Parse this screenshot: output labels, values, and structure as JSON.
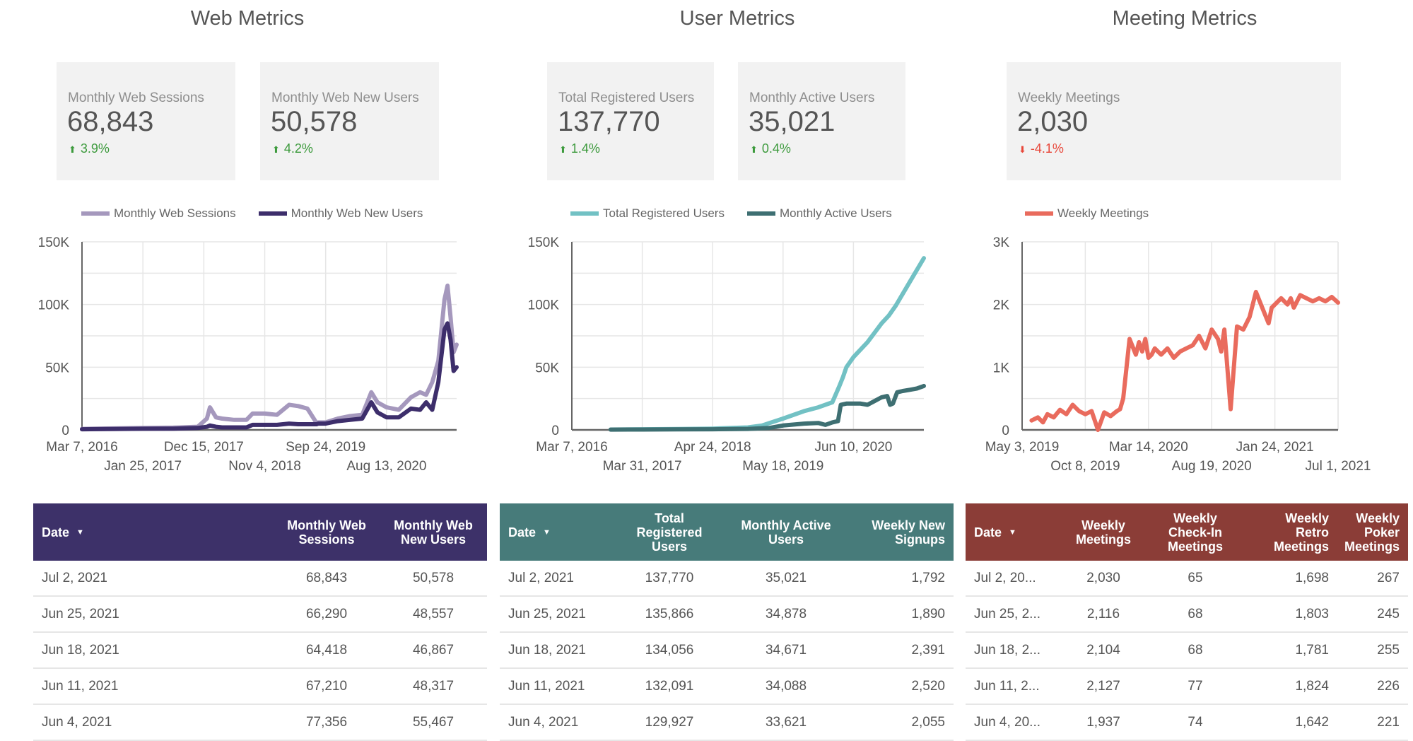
{
  "sections": {
    "web": {
      "title": "Web Metrics",
      "cards": [
        {
          "label": "Monthly Web Sessions",
          "value": "68,843",
          "delta": "3.9%",
          "direction": "up"
        },
        {
          "label": "Monthly Web New Users",
          "value": "50,578",
          "delta": "4.2%",
          "direction": "up"
        }
      ],
      "table": {
        "header_color": "#3d3169",
        "columns": [
          "Date",
          "Monthly Web Sessions",
          "Monthly Web New Users"
        ],
        "rows": [
          [
            "Jul 2, 2021",
            "68,843",
            "50,578"
          ],
          [
            "Jun 25, 2021",
            "66,290",
            "48,557"
          ],
          [
            "Jun 18, 2021",
            "64,418",
            "46,867"
          ],
          [
            "Jun 11, 2021",
            "67,210",
            "48,317"
          ],
          [
            "Jun 4, 2021",
            "77,356",
            "55,467"
          ]
        ]
      }
    },
    "user": {
      "title": "User Metrics",
      "cards": [
        {
          "label": "Total Registered Users",
          "value": "137,770",
          "delta": "1.4%",
          "direction": "up"
        },
        {
          "label": "Monthly Active Users",
          "value": "35,021",
          "delta": "0.4%",
          "direction": "up"
        }
      ],
      "table": {
        "header_color": "#477b7a",
        "columns": [
          "Date",
          "Total Registered Users",
          "Monthly Active Users",
          "Weekly New Signups"
        ],
        "rows": [
          [
            "Jul 2, 2021",
            "137,770",
            "35,021",
            "1,792"
          ],
          [
            "Jun 25, 2021",
            "135,866",
            "34,878",
            "1,890"
          ],
          [
            "Jun 18, 2021",
            "134,056",
            "34,671",
            "2,391"
          ],
          [
            "Jun 11, 2021",
            "132,091",
            "34,088",
            "2,520"
          ],
          [
            "Jun 4, 2021",
            "129,927",
            "33,621",
            "2,055"
          ]
        ]
      }
    },
    "meeting": {
      "title": "Meeting Metrics",
      "cards": [
        {
          "label": "Weekly Meetings",
          "value": "2,030",
          "delta": "-4.1%",
          "direction": "down"
        }
      ],
      "table": {
        "header_color": "#8b3d37",
        "columns": [
          "Date",
          "Weekly Meetings",
          "Weekly Check-In Meetings",
          "Weekly Retro Meetings",
          "Weekly Poker Meetings"
        ],
        "rows": [
          [
            "Jul 2, 20...",
            "2,030",
            "65",
            "1,698",
            "267"
          ],
          [
            "Jun 25, 2...",
            "2,116",
            "68",
            "1,803",
            "245"
          ],
          [
            "Jun 18, 2...",
            "2,104",
            "68",
            "1,781",
            "255"
          ],
          [
            "Jun 11, 2...",
            "2,127",
            "77",
            "1,824",
            "226"
          ],
          [
            "Jun 4, 20...",
            "1,937",
            "74",
            "1,642",
            "221"
          ]
        ]
      }
    }
  },
  "sort_icon": "sort-descending-triangle",
  "delta_icons": {
    "up": "arrow-up",
    "down": "arrow-down"
  },
  "colors": {
    "up": "#3c9a3c",
    "down": "#e8473a"
  },
  "chart_data": [
    {
      "type": "line",
      "title": "",
      "xlabel": "",
      "ylabel": "",
      "ylim": [
        0,
        150000
      ],
      "yticks": [
        "0",
        "50K",
        "100K",
        "150K"
      ],
      "xticks": [
        "Mar 7, 2016",
        "Jan 25, 2017",
        "Dec 15, 2017",
        "Nov 4, 2018",
        "Sep 24, 2019",
        "Aug 13, 2020"
      ],
      "xrange_index": [
        0,
        6.15
      ],
      "grid": true,
      "legend": "top",
      "series": [
        {
          "name": "Monthly Web Sessions",
          "color": "#a598bd",
          "x": [
            0,
            0.5,
            1,
            1.5,
            1.9,
            2.05,
            2.1,
            2.2,
            2.3,
            2.5,
            2.7,
            2.8,
            3.0,
            3.2,
            3.4,
            3.55,
            3.7,
            3.85,
            3.88,
            4.0,
            4.2,
            4.4,
            4.6,
            4.75,
            4.85,
            5.0,
            5.2,
            5.4,
            5.55,
            5.65,
            5.75,
            5.85,
            5.95,
            6.0,
            6.05,
            6.1,
            6.15
          ],
          "y": [
            800,
            1200,
            1500,
            1800,
            2500,
            9000,
            18000,
            10000,
            9000,
            8000,
            8000,
            13000,
            13000,
            12000,
            20000,
            19000,
            17000,
            5500,
            6000,
            6000,
            9000,
            11000,
            12000,
            30000,
            22000,
            18000,
            16000,
            26000,
            30000,
            28000,
            38000,
            55000,
            104000,
            115000,
            90000,
            62000,
            68000
          ]
        },
        {
          "name": "Monthly Web New Users",
          "color": "#3d2e6b",
          "x": [
            0,
            0.5,
            1,
            1.5,
            1.9,
            2.05,
            2.1,
            2.2,
            2.3,
            2.5,
            2.7,
            2.8,
            3.0,
            3.2,
            3.4,
            3.55,
            3.7,
            3.85,
            3.88,
            4.0,
            4.2,
            4.4,
            4.6,
            4.75,
            4.85,
            5.0,
            5.2,
            5.4,
            5.55,
            5.65,
            5.75,
            5.85,
            5.95,
            6.0,
            6.05,
            6.1,
            6.15
          ],
          "y": [
            500,
            700,
            900,
            1000,
            1500,
            2500,
            3500,
            2500,
            2000,
            2000,
            2000,
            4000,
            4000,
            4000,
            5000,
            4500,
            4500,
            4500,
            5000,
            5000,
            7000,
            8000,
            9000,
            22000,
            14000,
            10000,
            10000,
            17000,
            16000,
            22000,
            16000,
            38000,
            80000,
            85000,
            72000,
            47000,
            50000
          ]
        }
      ]
    },
    {
      "type": "line",
      "title": "",
      "xlabel": "",
      "ylabel": "",
      "ylim": [
        0,
        150000
      ],
      "yticks": [
        "0",
        "50K",
        "100K",
        "150K"
      ],
      "xticks": [
        "Mar 7, 2016",
        "Mar 31, 2017",
        "Apr 24, 2018",
        "May 18, 2019",
        "Jun 10, 2020"
      ],
      "xrange_index": [
        0,
        5
      ],
      "grid": true,
      "legend": "top",
      "series": [
        {
          "name": "Total Registered Users",
          "color": "#72c1c4",
          "x": [
            0.55,
            1,
            1.5,
            2,
            2.5,
            2.7,
            3.0,
            3.3,
            3.5,
            3.7,
            3.8,
            3.85,
            3.9,
            4.0,
            4.2,
            4.4,
            4.5,
            4.6,
            4.8,
            5.0
          ],
          "y": [
            300,
            500,
            700,
            1000,
            2000,
            3500,
            9000,
            15000,
            18000,
            22000,
            35000,
            42000,
            50000,
            58000,
            70000,
            85000,
            91000,
            99000,
            118000,
            137000
          ]
        },
        {
          "name": "Monthly Active Users",
          "color": "#3e6f72",
          "x": [
            0.55,
            1,
            1.5,
            2,
            2.5,
            2.8,
            3.0,
            3.3,
            3.5,
            3.6,
            3.7,
            3.78,
            3.82,
            3.9,
            4.0,
            4.1,
            4.2,
            4.3,
            4.4,
            4.48,
            4.52,
            4.56,
            4.62,
            4.7,
            4.8,
            4.9,
            5.0
          ],
          "y": [
            200,
            300,
            400,
            500,
            800,
            1500,
            3500,
            5000,
            5500,
            4000,
            6000,
            7000,
            20000,
            21000,
            21000,
            21000,
            20000,
            23000,
            26000,
            27000,
            20000,
            21000,
            30000,
            31000,
            32000,
            33000,
            35000
          ]
        }
      ]
    },
    {
      "type": "line",
      "title": "",
      "xlabel": "",
      "ylabel": "",
      "ylim": [
        0,
        3000
      ],
      "yticks": [
        "0",
        "1K",
        "2K",
        "3K"
      ],
      "xticks": [
        "May 3, 2019",
        "Oct 8, 2019",
        "Mar 14, 2020",
        "Aug 19, 2020",
        "Jan 24, 2021",
        "Jul 1, 2021"
      ],
      "xrange_index": [
        0,
        5
      ],
      "grid": true,
      "legend": "top",
      "series": [
        {
          "name": "Weekly Meetings",
          "color": "#e96b5d",
          "x": [
            0.15,
            0.25,
            0.33,
            0.4,
            0.5,
            0.6,
            0.7,
            0.8,
            0.9,
            1.0,
            1.1,
            1.2,
            1.3,
            1.4,
            1.5,
            1.55,
            1.6,
            1.7,
            1.8,
            1.85,
            1.9,
            1.95,
            2.0,
            2.05,
            2.1,
            2.15,
            2.2,
            2.3,
            2.4,
            2.5,
            2.6,
            2.7,
            2.8,
            2.9,
            3.0,
            3.1,
            3.15,
            3.2,
            3.3,
            3.4,
            3.5,
            3.6,
            3.7,
            3.8,
            3.9,
            3.95,
            4.0,
            4.1,
            4.2,
            4.25,
            4.3,
            4.4,
            4.5,
            4.6,
            4.7,
            4.8,
            4.9,
            5.0
          ],
          "y": [
            150,
            200,
            120,
            250,
            200,
            320,
            250,
            400,
            300,
            250,
            300,
            0,
            280,
            220,
            300,
            330,
            500,
            1450,
            1200,
            1400,
            1250,
            1450,
            1150,
            1200,
            1300,
            1250,
            1200,
            1300,
            1150,
            1250,
            1300,
            1350,
            1500,
            1300,
            1600,
            1450,
            1250,
            1600,
            330,
            1650,
            1600,
            1800,
            2200,
            1950,
            1700,
            1950,
            2000,
            2100,
            2000,
            2100,
            1950,
            2150,
            2100,
            2050,
            2100,
            2050,
            2120,
            2030
          ]
        }
      ]
    }
  ]
}
